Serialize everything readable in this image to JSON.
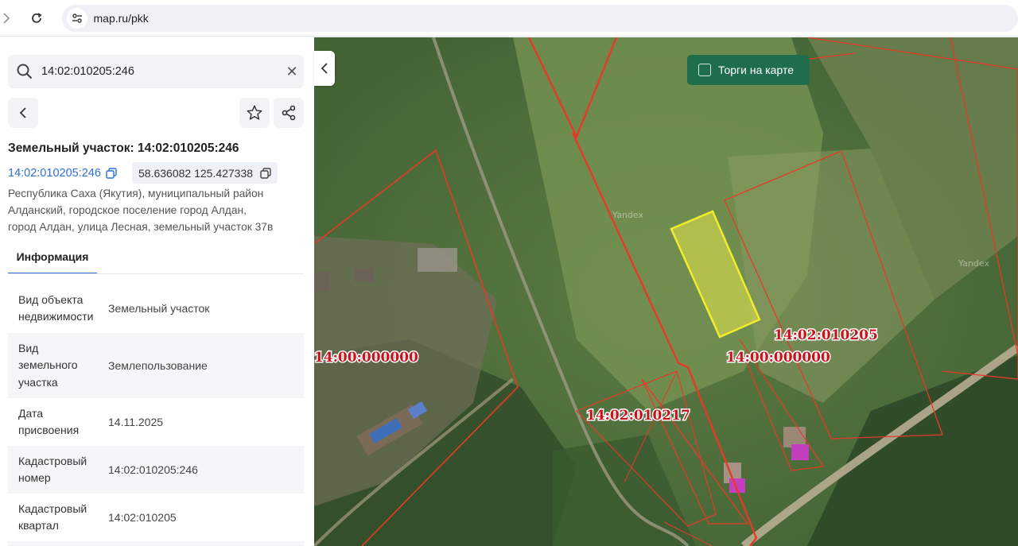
{
  "browser": {
    "url": "map.ru/pkk"
  },
  "search": {
    "value": "14:02:010205:246"
  },
  "object": {
    "title": "Земельный участок: 14:02:010205:246",
    "cad_number_link": "14:02:010205:246",
    "coordinates": "58.636082 125.427338",
    "address_lines": [
      "Республика Саха (Якутия), муниципальный район",
      "Алданский, городское поселение город Алдан,",
      "город Алдан, улица Лесная, земельный участок 37в"
    ]
  },
  "tabs": {
    "info": "Информация"
  },
  "info_rows": [
    {
      "key": [
        "Вид объекта",
        "недвижимости"
      ],
      "value": "Земельный участок"
    },
    {
      "key": [
        "Вид",
        "земельного",
        "участка"
      ],
      "value": "Землепользование"
    },
    {
      "key": [
        "Дата",
        "присвоения"
      ],
      "value": "14.11.2025"
    },
    {
      "key": [
        "Кадастровый",
        "номер"
      ],
      "value": "14:02:010205:246"
    },
    {
      "key": [
        "Кадастровый",
        "квартал"
      ],
      "value": "14:02:010205"
    }
  ],
  "map": {
    "auction_label": "Торги на карте",
    "cadastral_labels": {
      "label_a": "14:00:000000",
      "label_b": "14:02:010205",
      "label_c": "14:00:000000",
      "label_d": "14:02:010217"
    },
    "watermark": "Yandex"
  },
  "colors": {
    "accent": "#2f6fd6",
    "auction_bg": "#1e6e4e",
    "parcel_highlight": "#e8e84a",
    "boundary": "#e53a2a"
  }
}
